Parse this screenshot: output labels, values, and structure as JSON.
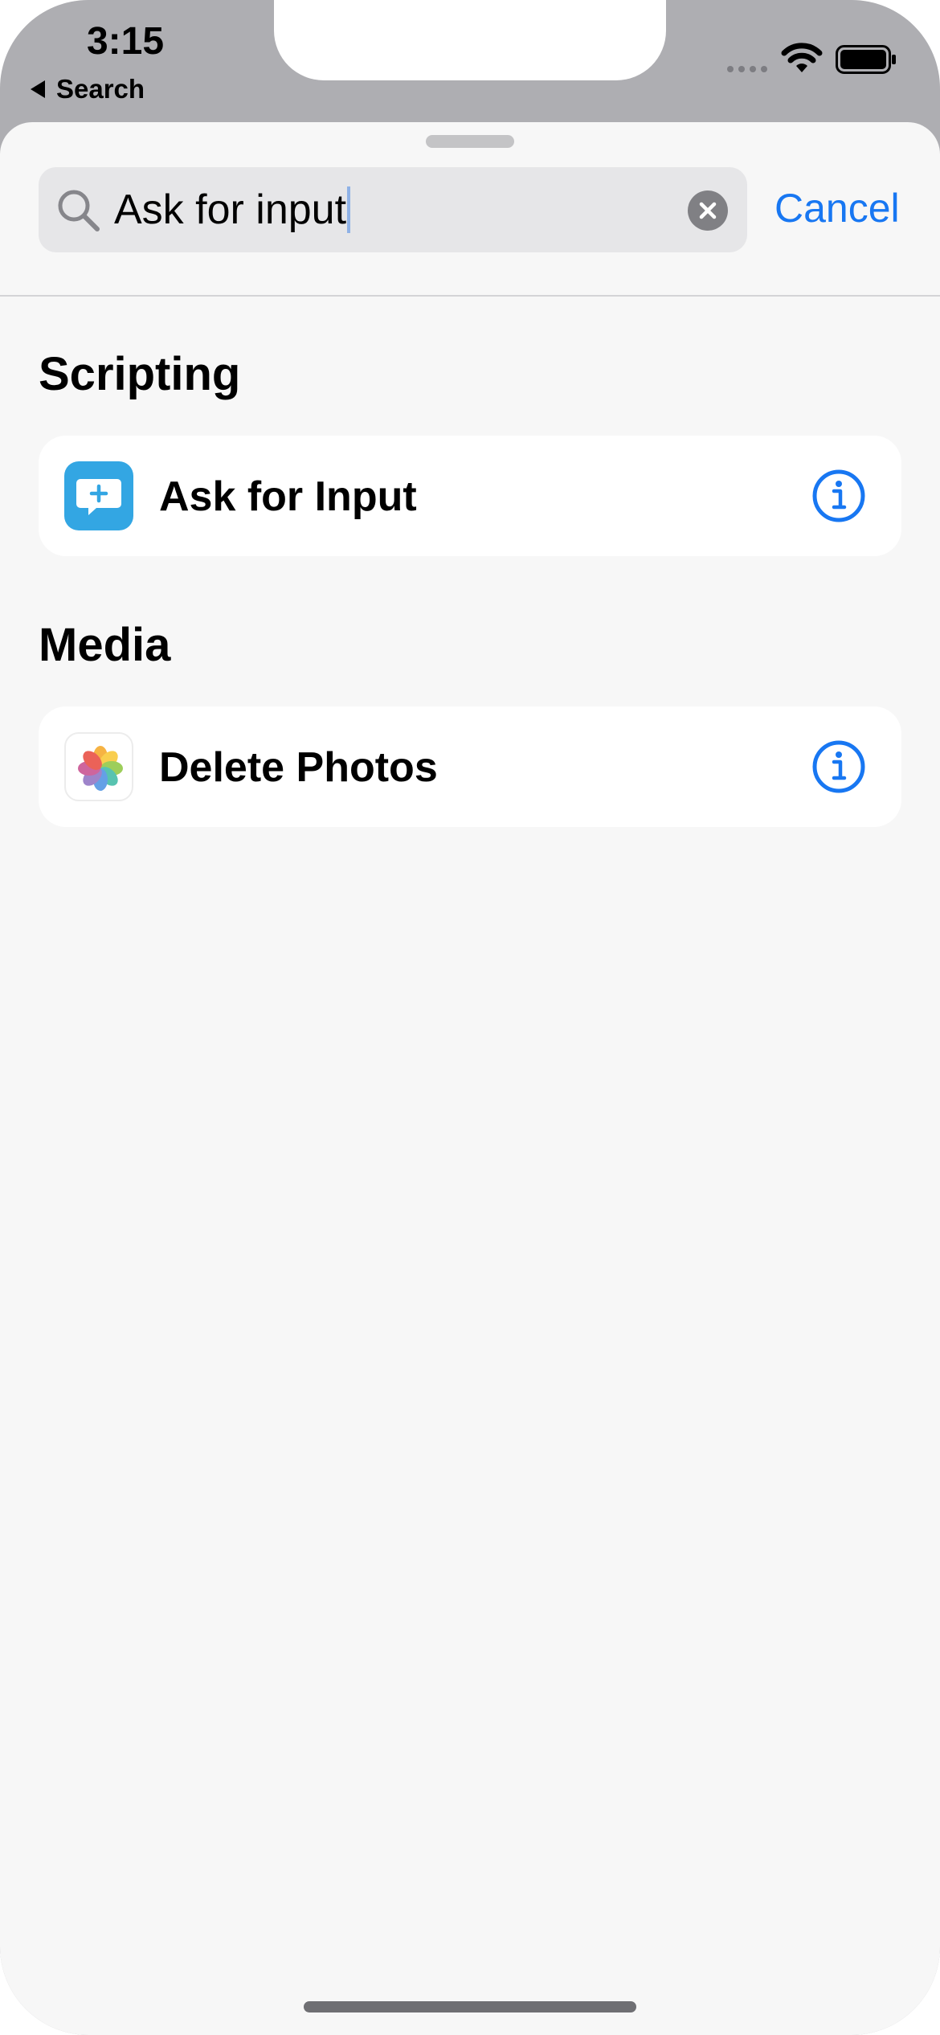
{
  "status_bar": {
    "time": "3:15",
    "back_label": "Search",
    "icons": [
      "cellular-signal-icon",
      "wifi-icon",
      "battery-icon"
    ]
  },
  "search": {
    "value": "Ask for input",
    "cancel_label": "Cancel",
    "icons": [
      "search-icon",
      "clear-icon"
    ]
  },
  "sections": [
    {
      "title": "Scripting",
      "items": [
        {
          "label": "Ask for Input",
          "icon": "ask-for-input-icon",
          "accessory": "info-icon"
        }
      ]
    },
    {
      "title": "Media",
      "items": [
        {
          "label": "Delete Photos",
          "icon": "photos-icon",
          "accessory": "info-icon"
        }
      ]
    }
  ],
  "colors": {
    "accent": "#1877f2",
    "scripting_icon": "#33a6e3",
    "sheet_background": "#f7f7f7",
    "search_field": "#e6e6e8"
  }
}
